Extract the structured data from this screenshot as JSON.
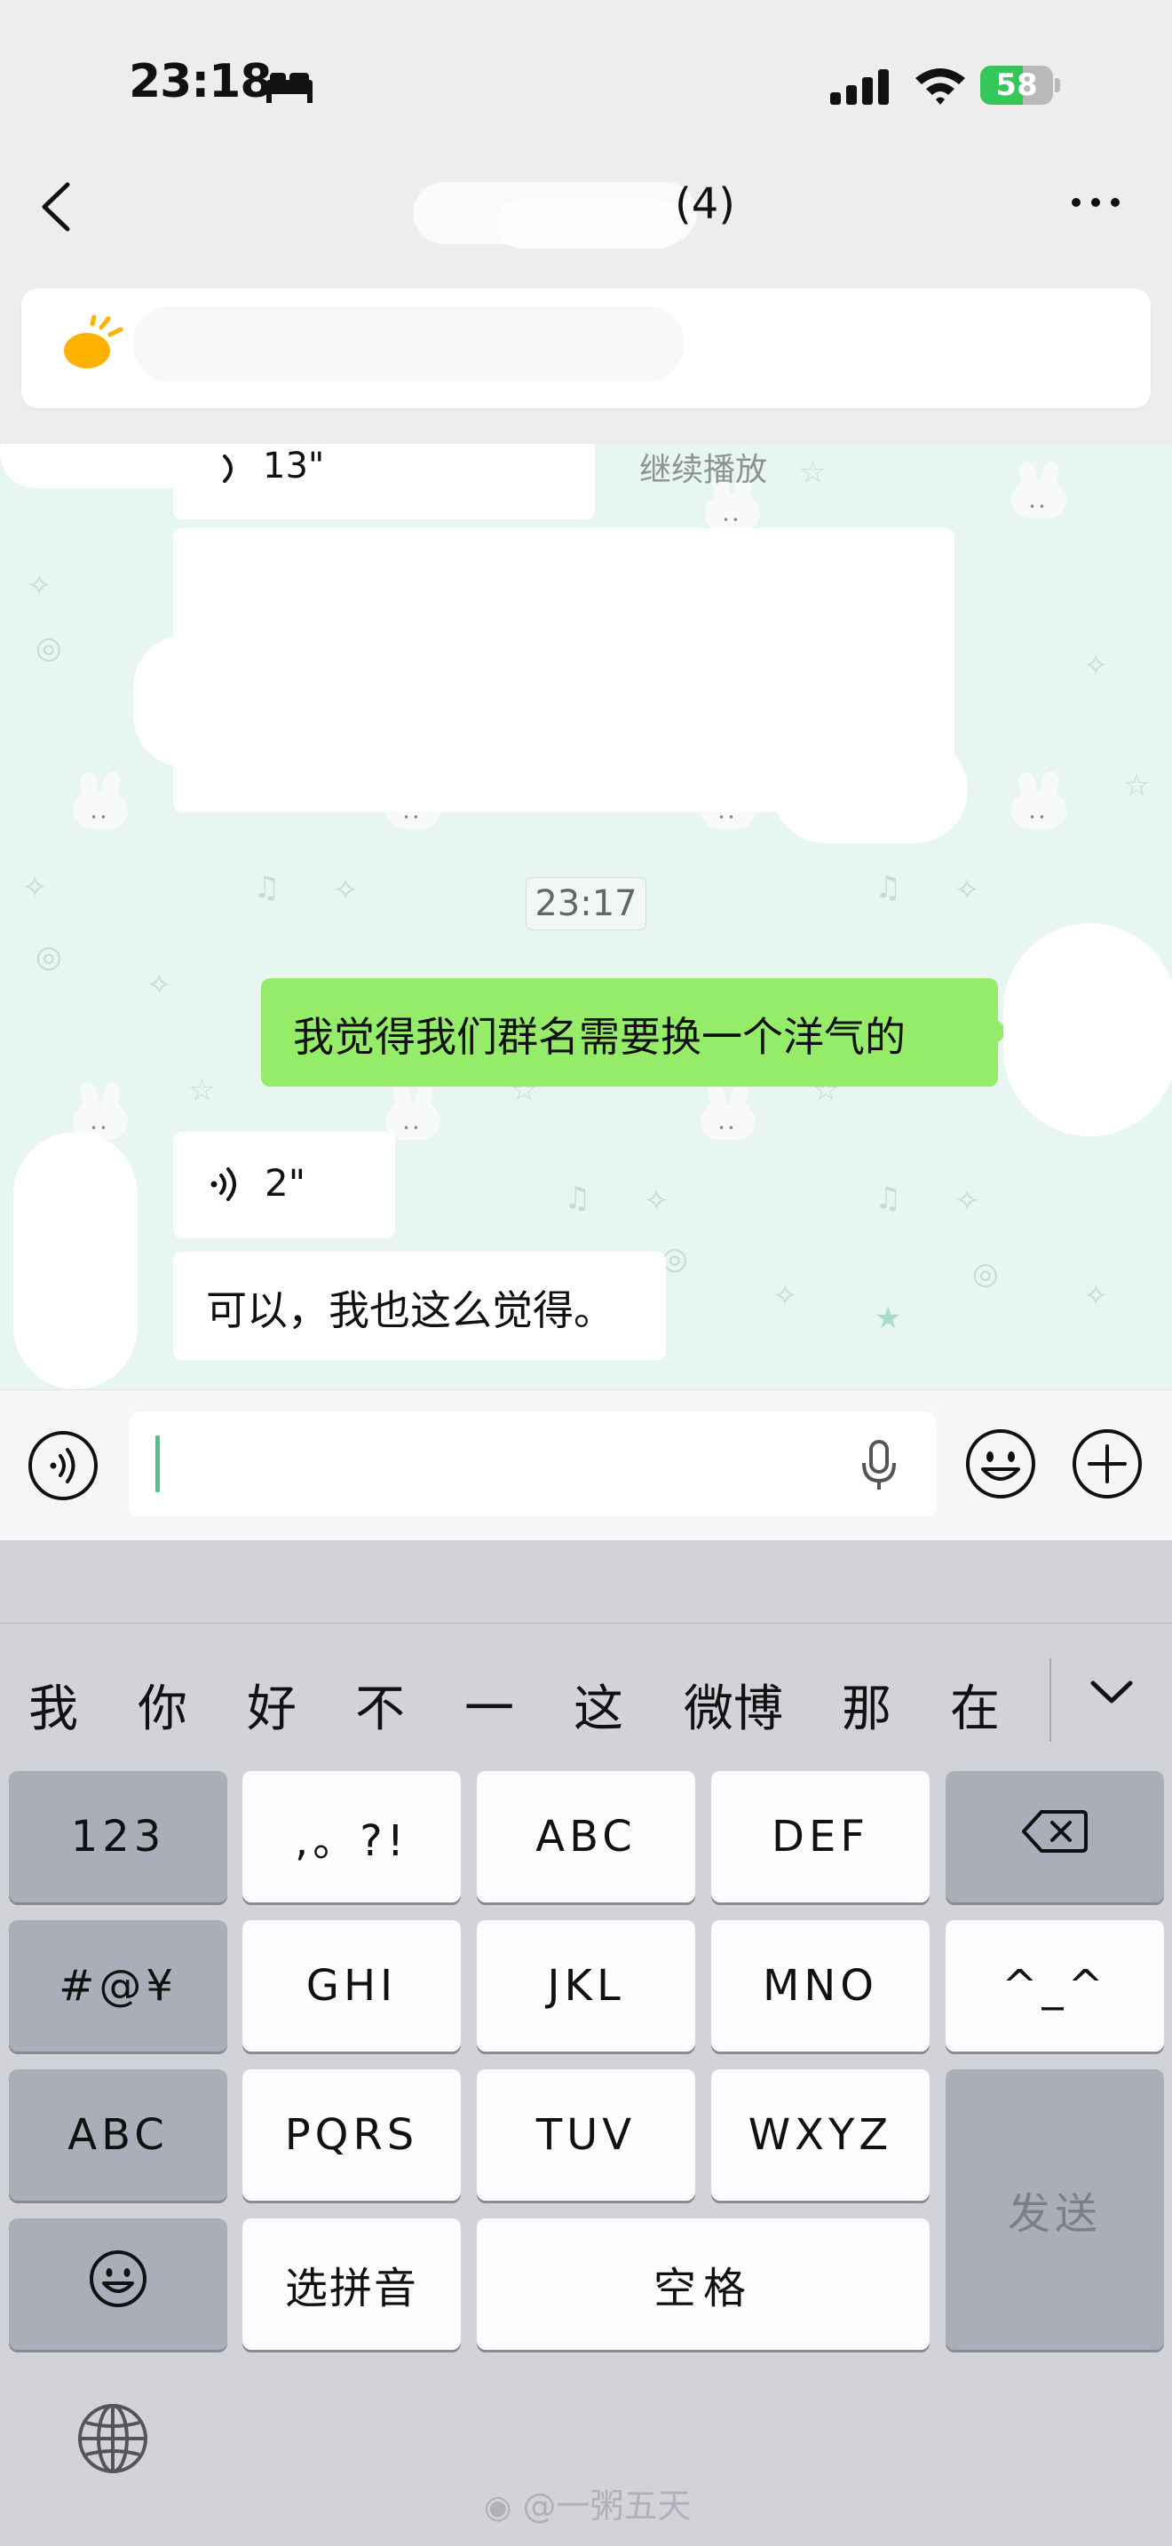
{
  "status_bar": {
    "time": "23:18",
    "battery": "58",
    "battery_level": 0.58
  },
  "nav": {
    "title": "(4)"
  },
  "chat": {
    "partial_voice_duration": "13\"",
    "continue_label": "继续播放",
    "timestamp": "23:17",
    "messages": [
      {
        "side": "right",
        "type": "text",
        "text": "我觉得我们群名需要换一个洋气的"
      },
      {
        "side": "left",
        "type": "voice",
        "duration": "2\""
      },
      {
        "side": "left",
        "type": "text",
        "text": "可以，我也这么觉得。"
      }
    ]
  },
  "candidates": [
    "我",
    "你",
    "好",
    "不",
    "一",
    "这",
    "微博",
    "那",
    "在"
  ],
  "keys": {
    "k_123": "123",
    "k_punct": ",。?!",
    "k_abc": "ABC",
    "k_def": "DEF",
    "k_sym": "#@¥",
    "k_ghi": "GHI",
    "k_jkl": "JKL",
    "k_mno": "MNO",
    "k_face": "^_^",
    "k_abc_mode": "ABC",
    "k_pqrs": "PQRS",
    "k_tuv": "TUV",
    "k_wxyz": "WXYZ",
    "k_pinyin": "选拼音",
    "k_space": "空格",
    "k_send": "发送"
  },
  "watermark": "@一粥五天",
  "colors": {
    "bubble_green": "#95ec69",
    "chat_bg": "#e8f6f1",
    "keyboard_bg": "#d1d3d9"
  }
}
